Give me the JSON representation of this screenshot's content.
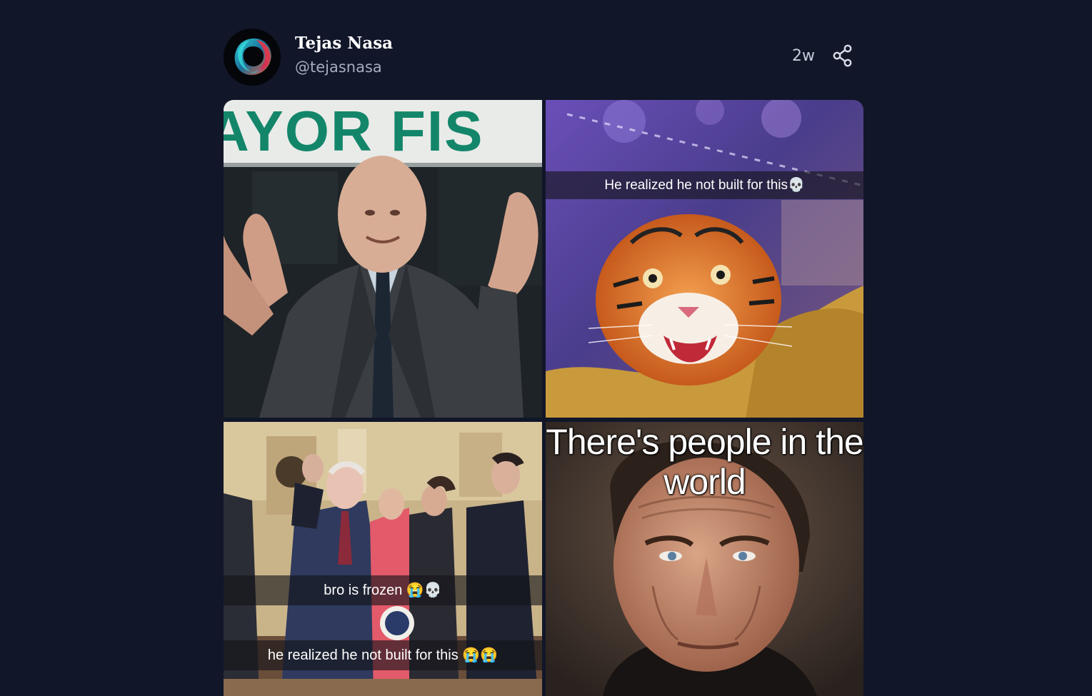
{
  "post": {
    "author": {
      "display_name": "Tejas Nasa",
      "handle": "@tejasnasa",
      "avatar_icon": "abstract-ring-avatar"
    },
    "age": "2w",
    "share_icon": "share-icon",
    "images": [
      {
        "id": "mayor-fisk",
        "banner_text": "AYOR FIS",
        "description_icon": "man-in-suit-shrugging"
      },
      {
        "id": "tiger",
        "caption": "He realized he not built for this💀",
        "description_icon": "startled-tiger"
      },
      {
        "id": "senator-frozen",
        "captions": [
          "bro is frozen 😭💀",
          "he realized he not built for this 😭😭"
        ],
        "description_icon": "press-conference"
      },
      {
        "id": "dafoe",
        "headline": "There's people in the world",
        "description_icon": "portrait-man"
      }
    ]
  },
  "colors": {
    "background": "#111629",
    "handle": "#a6acc0",
    "banner_green": "#13866a"
  }
}
